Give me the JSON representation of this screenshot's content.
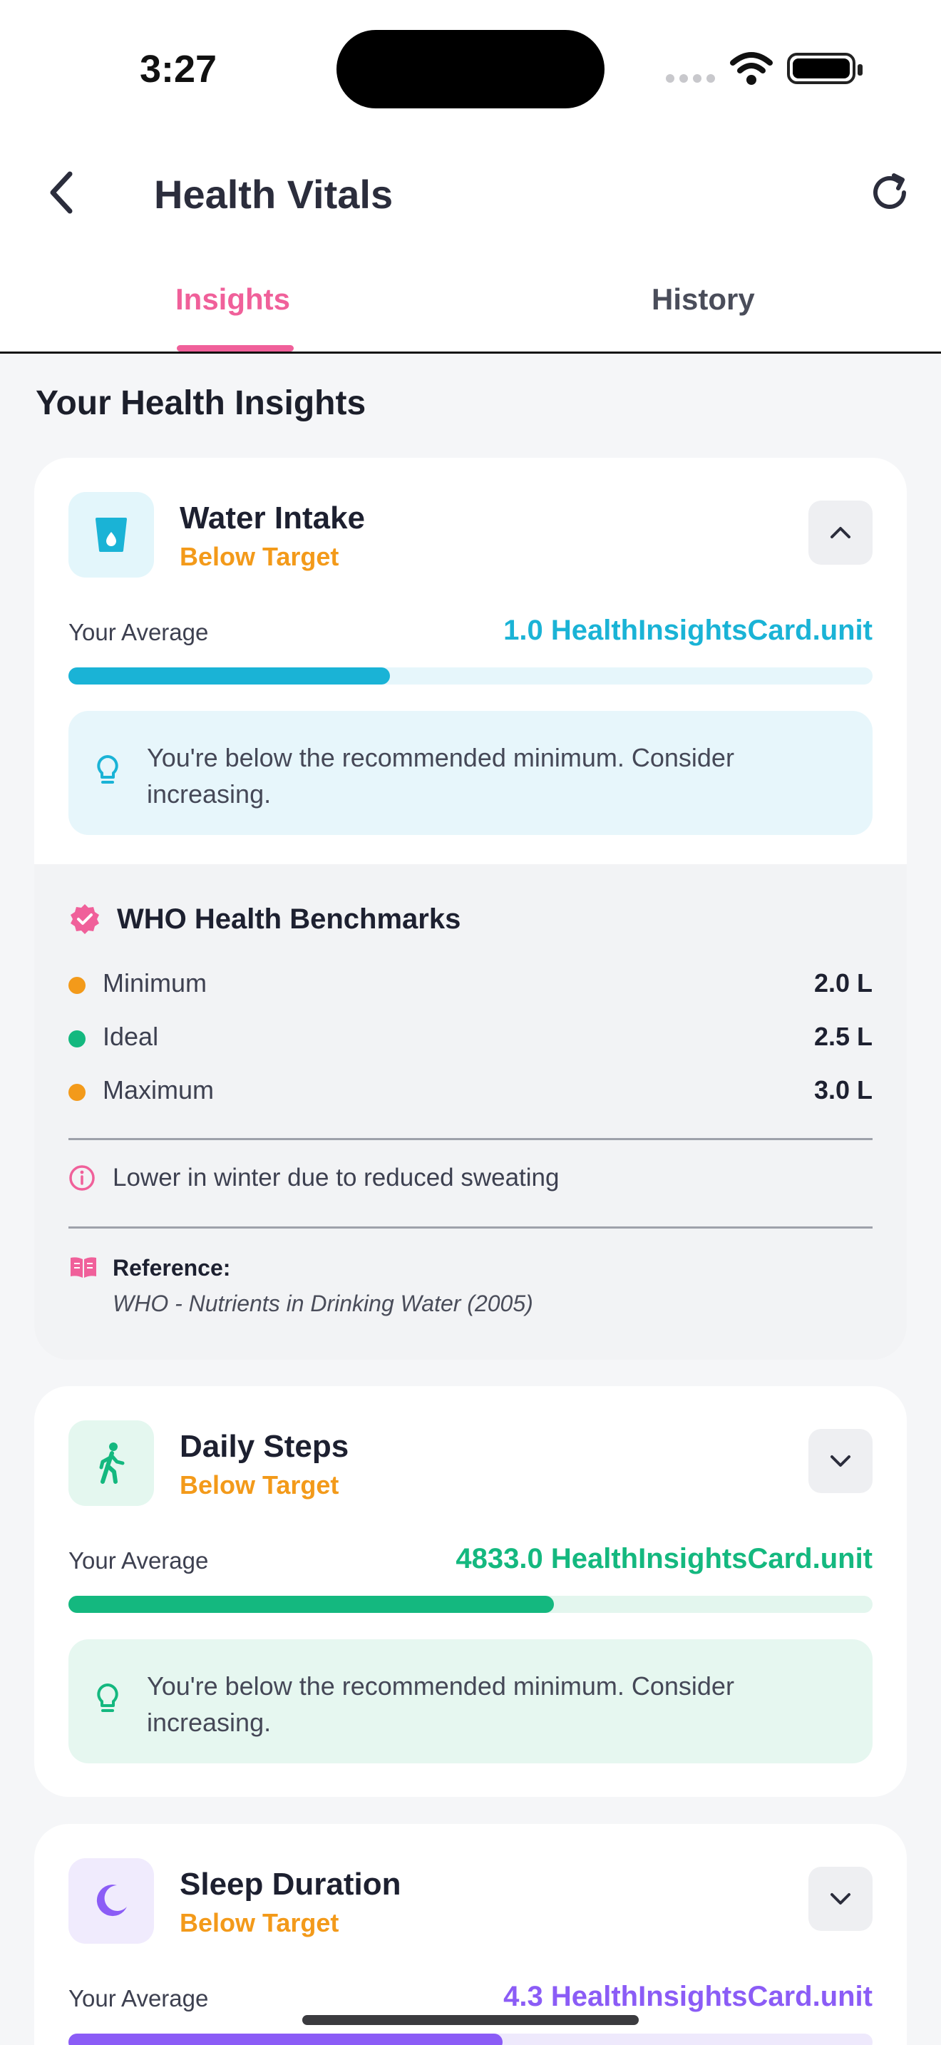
{
  "status_bar": {
    "time": "3:27"
  },
  "nav": {
    "title": "Health Vitals"
  },
  "tabs": [
    {
      "label": "Insights",
      "active": true
    },
    {
      "label": "History",
      "active": false
    }
  ],
  "section_title": "Your Health Insights",
  "colors": {
    "accent_pink": "#f0609a",
    "status_orange": "#f39a1a",
    "water": "#1ab3d6",
    "steps": "#14b87f",
    "sleep": "#8b5cf6"
  },
  "cards": [
    {
      "title": "Water Intake",
      "status": "Below Target",
      "icon": "water-glass-icon",
      "expanded": true,
      "avg_label": "Your Average",
      "avg_value": "1.0 HealthInsightsCard.unit",
      "progress_fraction": 0.4,
      "tip": "You're below the recommended minimum. Consider increasing.",
      "benchmarks": {
        "title": "WHO Health Benchmarks",
        "rows": [
          {
            "label": "Minimum",
            "value": "2.0 L"
          },
          {
            "label": "Ideal",
            "value": "2.5 L"
          },
          {
            "label": "Maximum",
            "value": "3.0 L"
          }
        ],
        "note": "Lower in winter due to reduced sweating",
        "reference_label": "Reference:",
        "reference_text": "WHO - Nutrients in Drinking Water (2005)"
      }
    },
    {
      "title": "Daily Steps",
      "status": "Below Target",
      "icon": "walking-person-icon",
      "expanded": false,
      "avg_label": "Your Average",
      "avg_value": "4833.0 HealthInsightsCard.unit",
      "progress_fraction": 0.604,
      "tip": "You're below the recommended minimum. Consider increasing."
    },
    {
      "title": "Sleep Duration",
      "status": "Below Target",
      "icon": "moon-icon",
      "expanded": false,
      "avg_label": "Your Average",
      "avg_value": "4.3 HealthInsightsCard.unit",
      "progress_fraction": 0.54
    }
  ]
}
